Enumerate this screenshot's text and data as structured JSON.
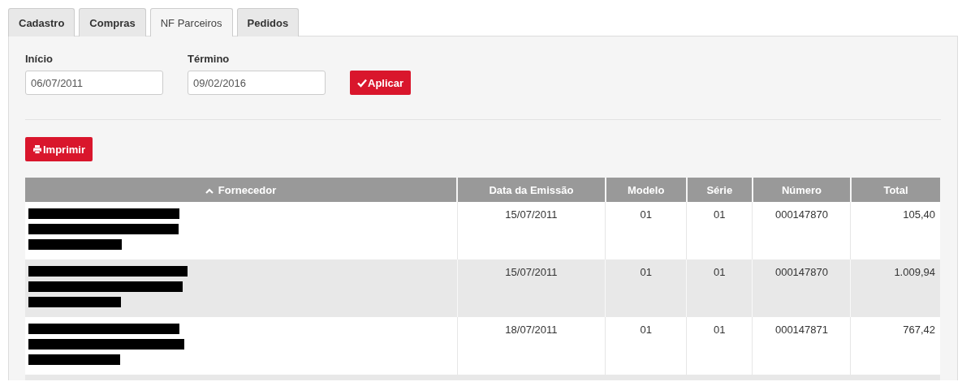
{
  "tabs": [
    {
      "label": "Cadastro",
      "selected": false
    },
    {
      "label": "Compras",
      "selected": false
    },
    {
      "label": "NF Parceiros",
      "selected": true
    },
    {
      "label": "Pedidos",
      "selected": false
    }
  ],
  "filters": [
    {
      "label": "Início",
      "value": "06/07/2011"
    },
    {
      "label": "Término",
      "value": "09/02/2016"
    }
  ],
  "apply_button": "Aplicar",
  "print_button": "Imprimir",
  "table": {
    "columns": [
      {
        "label": "Fornecedor",
        "sorted": true
      },
      {
        "label": "Data da Emissão",
        "sorted": false
      },
      {
        "label": "Modelo",
        "sorted": false
      },
      {
        "label": "Série",
        "sorted": false
      },
      {
        "label": "Número",
        "sorted": false
      },
      {
        "label": "Total",
        "sorted": false
      }
    ],
    "rows": [
      {
        "redacted": true,
        "cells": [
          "",
          "15/07/2011",
          "01",
          "01",
          "000147870",
          "105,40"
        ]
      },
      {
        "redacted": true,
        "cells": [
          "",
          "15/07/2011",
          "01",
          "01",
          "000147870",
          "1.009,94"
        ]
      },
      {
        "redacted": true,
        "cells": [
          "",
          "18/07/2011",
          "01",
          "01",
          "000147871",
          "767,42"
        ]
      }
    ]
  }
}
